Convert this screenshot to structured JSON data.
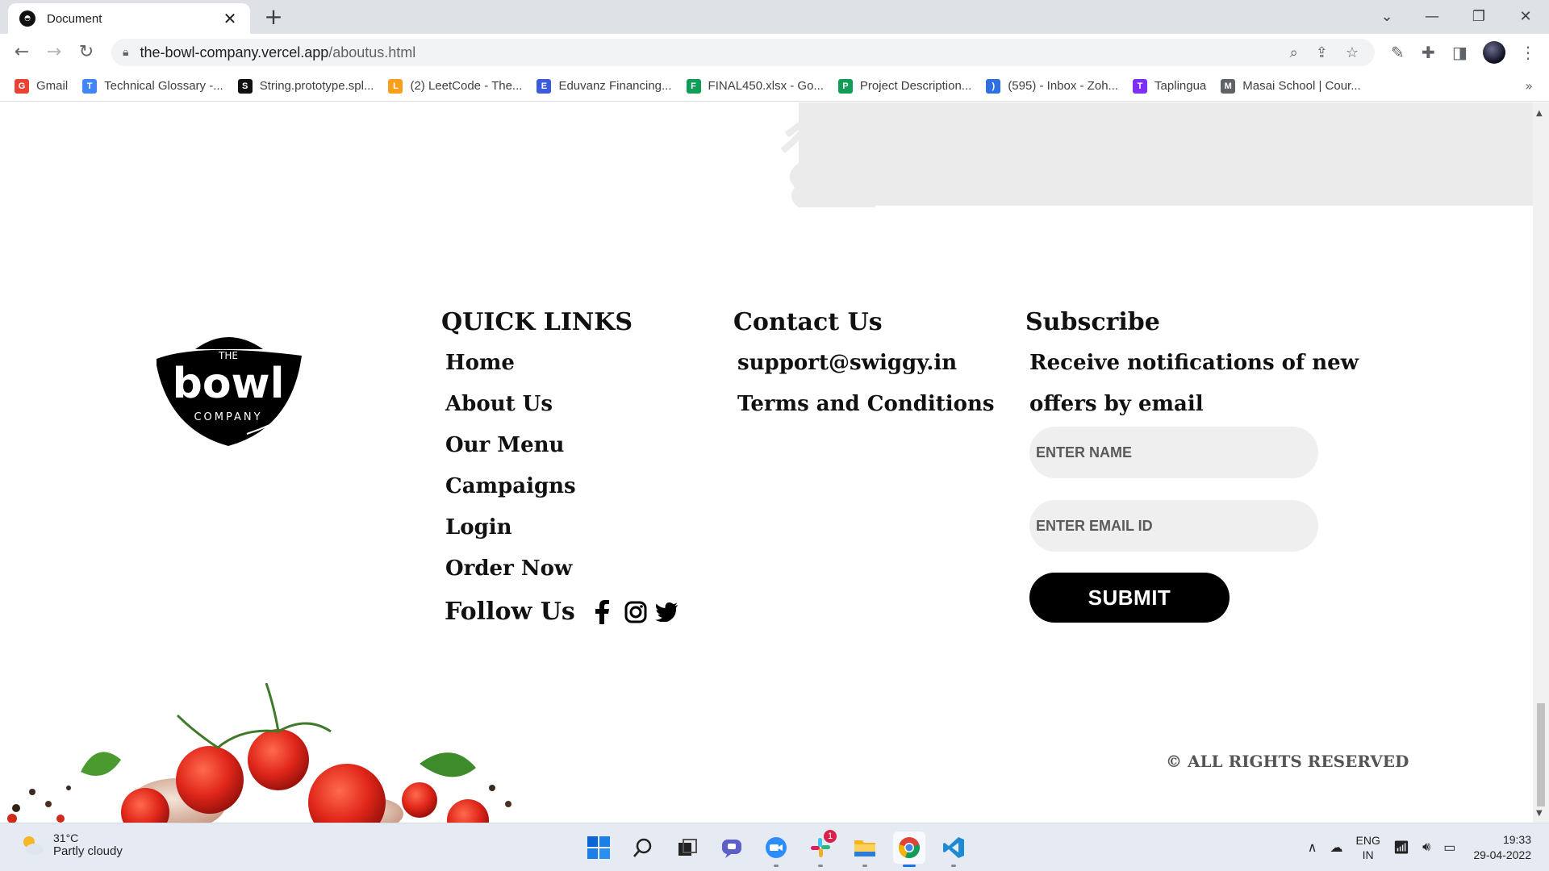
{
  "browser": {
    "tab_title": "Document",
    "url_host": "the-bowl-company.vercel.app",
    "url_path": "/aboutus.html",
    "bookmarks": [
      {
        "label": "Gmail",
        "icon": "gmail-icon",
        "color": "#ea4335"
      },
      {
        "label": "Technical Glossary -...",
        "icon": "docs-icon",
        "color": "#4285f4"
      },
      {
        "label": "String.prototype.spl...",
        "icon": "mdn-icon",
        "color": "#111111"
      },
      {
        "label": "(2) LeetCode - The...",
        "icon": "leetcode-icon",
        "color": "#f89f1b"
      },
      {
        "label": "Eduvanz Financing...",
        "icon": "eduvanz-icon",
        "color": "#3b5bdb"
      },
      {
        "label": "FINAL450.xlsx - Go...",
        "icon": "drive-icon",
        "color": "#0f9d58"
      },
      {
        "label": "Project Description...",
        "icon": "sheets-icon",
        "color": "#0f9d58"
      },
      {
        "label": "(595) - Inbox - Zoh...",
        "icon": "zoho-mail-icon",
        "color": "#2f6fde"
      },
      {
        "label": "Taplingua",
        "icon": "taplingua-icon",
        "color": "#7b2ff7"
      },
      {
        "label": "Masai School | Cour...",
        "icon": "globe-icon",
        "color": "#5f6368"
      }
    ]
  },
  "footer": {
    "logo": {
      "top_text": "THE",
      "main_text": "bowl",
      "bottom_text": "COMPANY"
    },
    "quick_links": {
      "title": "QUICK LINKS",
      "items": [
        "Home",
        "About Us",
        "Our Menu",
        "Campaigns",
        "Login",
        "Order Now"
      ]
    },
    "follow": {
      "label": "Follow Us",
      "icons": [
        "facebook-icon",
        "instagram-icon",
        "twitter-icon"
      ]
    },
    "contact": {
      "title": "Contact Us",
      "items": [
        "support@swiggy.in",
        "Terms and Conditions"
      ]
    },
    "subscribe": {
      "title": "Subscribe",
      "text_line1": "Receive notifications of new",
      "text_line2": "offers by email",
      "name_placeholder": "ENTER NAME",
      "email_placeholder": "ENTER EMAIL ID",
      "submit_label": "SUBMIT"
    },
    "rights": "© ALL RIGHTS RESERVED"
  },
  "taskbar": {
    "weather_temp": "31°C",
    "weather_desc": "Partly cloudy",
    "slack_badge": "1",
    "lang_top": "ENG",
    "lang_bottom": "IN",
    "time": "19:33",
    "date": "29-04-2022"
  }
}
